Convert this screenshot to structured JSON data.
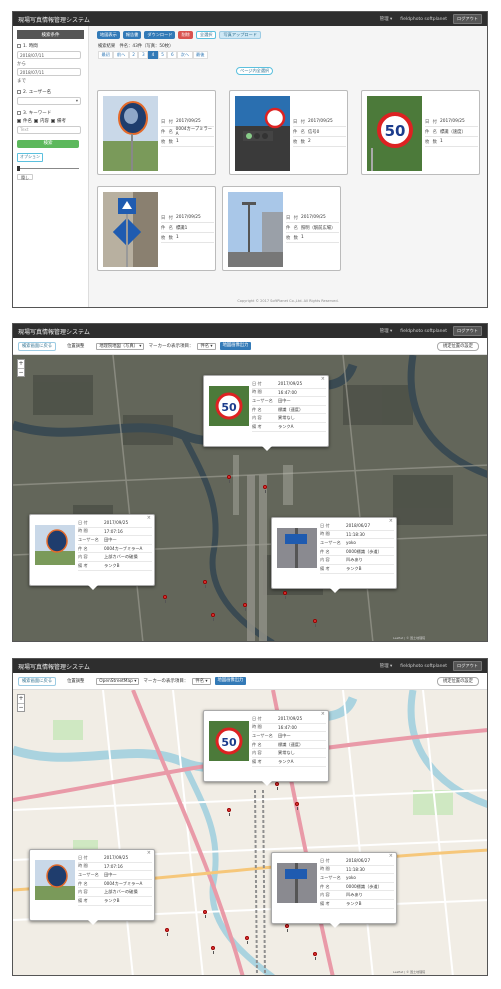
{
  "app": {
    "title": "現場写真情報管理システム",
    "menu_manage": "管理 ▾",
    "user": "fieldphoto softplanet",
    "logout": "ログアウト"
  },
  "sidebar": {
    "title": "検索条件",
    "period_label": "1. 時間",
    "date_from": "2018/07/11",
    "from_label": "から",
    "date_to": "2018/07/11",
    "to_label": "まで",
    "user_label": "2. ユーザー名",
    "keyword_label": "3. キーワード",
    "kw_opt1": "件名",
    "kw_opt2": "内容",
    "kw_opt3": "備考",
    "text_placeholder": "Text",
    "search_button": "検索",
    "options_button": "オプション",
    "hide_button": "隠し",
    "slider_value": 0
  },
  "toolbar": {
    "map_view": "地図表示",
    "report": "報告書",
    "download": "ダウンロード",
    "delete": "削除",
    "select_all": "全選択",
    "photo_upload": "写真アップロード"
  },
  "results": {
    "summary": "検索結果　件名：43件（写真：50枚）",
    "select_page": "ページ内全選択",
    "pager": [
      "最初",
      "前へ",
      "2",
      "3",
      "4",
      "5",
      "6",
      "次へ",
      "最後"
    ],
    "active_page": "4"
  },
  "labels": {
    "date": "日 付",
    "time": "時 間",
    "user": "ユーザー名",
    "subject": "件 名",
    "content": "内 容",
    "note": "備 考",
    "count": "枚 数"
  },
  "cards": [
    {
      "date": "2017/09/25",
      "subject": "0004カーブミラーA",
      "count": "1"
    },
    {
      "date": "2017/09/25",
      "subject": "信号0",
      "count": "2"
    },
    {
      "date": "2017/09/25",
      "subject": "標識（速度）",
      "count": "1"
    },
    {
      "date": "2017/09/25",
      "subject": "標識1",
      "count": "1"
    },
    {
      "date": "2017/09/25",
      "subject": "照明（駅前広場）",
      "count": "1"
    }
  ],
  "footer": "Copyright © 2017 SoftPlanet Co.,Ltd. All Rights Reserved.",
  "map_toolbar": {
    "back": "検索画面に戻る",
    "position_adjust": "位置調整",
    "map_type_sat": "地理院地図（写真）",
    "map_type_osm": "OpenStreetMap",
    "marker_label": "マーカーの表示項目：",
    "marker_field": "件名",
    "print": "地図画像出力",
    "set_default": "規定位置の設定"
  },
  "popups": [
    {
      "date": "2017/09/25",
      "time": "16:47:00",
      "user": "田中一",
      "subject": "標識（速度）",
      "content": "異常なし",
      "note": "ランクA"
    },
    {
      "date": "2017/09/25",
      "time": "17:07:16",
      "user": "田中一",
      "subject": "0004カーブミラーA",
      "content": "上部カバーの破損",
      "note": "ランクB"
    },
    {
      "date": "2018/06/27",
      "time": "11:18:30",
      "user": "yoko",
      "subject": "0000標識（歩道）",
      "content": "凹みあり",
      "note": "ランクB"
    }
  ],
  "map_copyright": "Leaflet | © 国土地理院"
}
